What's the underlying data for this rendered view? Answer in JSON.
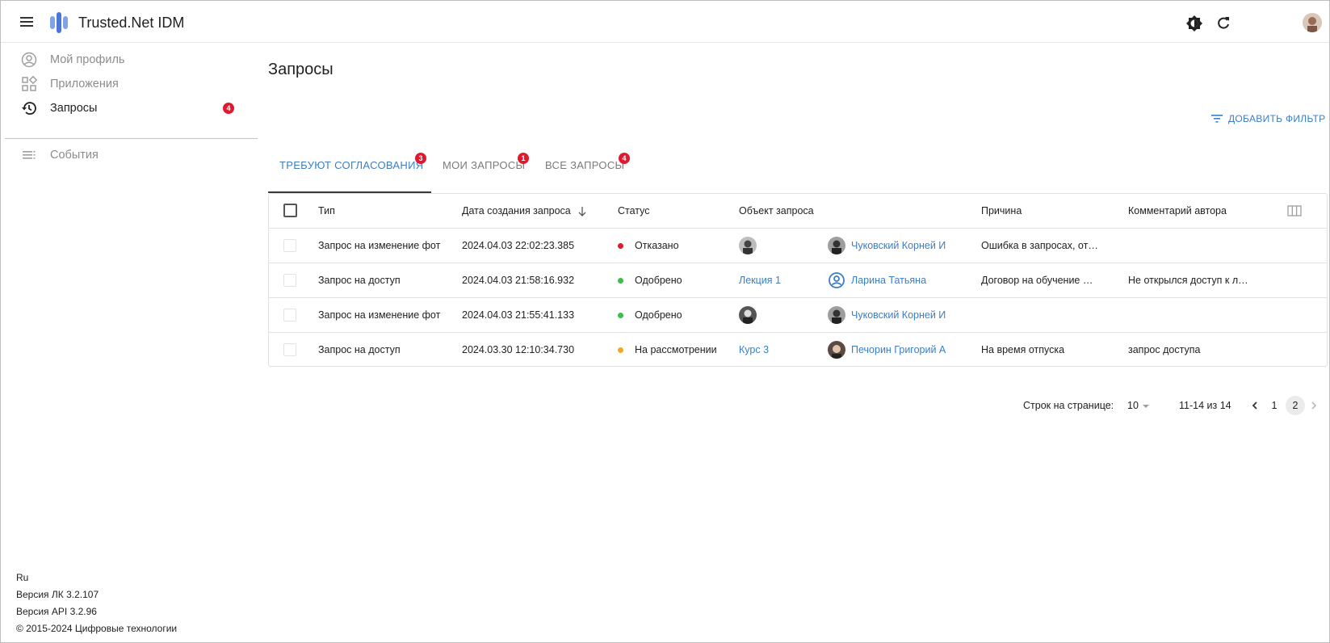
{
  "app": {
    "title": "Trusted.Net IDM"
  },
  "sidebar": {
    "items": [
      {
        "label": "Мой профиль",
        "icon": "account-circle-icon"
      },
      {
        "label": "Приложения",
        "icon": "apps-icon"
      },
      {
        "label": "Запросы",
        "icon": "history-icon",
        "badge": "4"
      },
      {
        "label": "События",
        "icon": "list-icon"
      }
    ],
    "footer": {
      "lang": "Ru",
      "version_lk": "Версия ЛК 3.2.107",
      "version_api": "Версия API 3.2.96",
      "copyright": "© 2015-2024 Цифровые технологии"
    }
  },
  "main": {
    "title": "Запросы",
    "add_filter": "ДОБАВИТЬ ФИЛЬТР",
    "tabs": [
      {
        "label": "ТРЕБУЮТ СОГЛАСОВАНИЯ",
        "badge": "3"
      },
      {
        "label": "МОИ ЗАПРОСЫ",
        "badge": "1"
      },
      {
        "label": "ВСЕ ЗАПРОСЫ",
        "badge": "4"
      }
    ]
  },
  "table": {
    "columns": {
      "type": "Тип",
      "date": "Дата создания запроса",
      "status": "Статус",
      "object": "Объект запроса",
      "reason": "Причина",
      "comment": "Комментарий автора"
    },
    "rows": [
      {
        "type": "Запрос на изменение фот",
        "date": "2024.04.03 22:02:23.385",
        "status": "Отказано",
        "status_color": "#e0192e",
        "object": "",
        "person": "Чуковский Корней И",
        "reason": "Ошибка в запросах, от…",
        "comment": ""
      },
      {
        "type": "Запрос на доступ",
        "date": "2024.04.03 21:58:16.932",
        "status": "Одобрено",
        "status_color": "#3bbf4b",
        "object": "Лекция 1",
        "person": "Ларина Татьяна",
        "reason": "Договор на обучение …",
        "comment": "Не открылся доступ к л…"
      },
      {
        "type": "Запрос на изменение фот",
        "date": "2024.04.03 21:55:41.133",
        "status": "Одобрено",
        "status_color": "#3bbf4b",
        "object": "",
        "person": "Чуковский Корней И",
        "reason": "",
        "comment": ""
      },
      {
        "type": "Запрос на доступ",
        "date": "2024.03.30 12:10:34.730",
        "status": "На рассмотрении",
        "status_color": "#f5a623",
        "object": "Курс 3",
        "person": "Печорин Григорий А",
        "reason": "На время отпуска",
        "comment": "запрос доступа"
      }
    ]
  },
  "pagination": {
    "rows_label": "Строк на странице:",
    "rows_value": "10",
    "range": "11-14 из 14",
    "pages": [
      "1",
      "2"
    ],
    "current_page": "2"
  }
}
